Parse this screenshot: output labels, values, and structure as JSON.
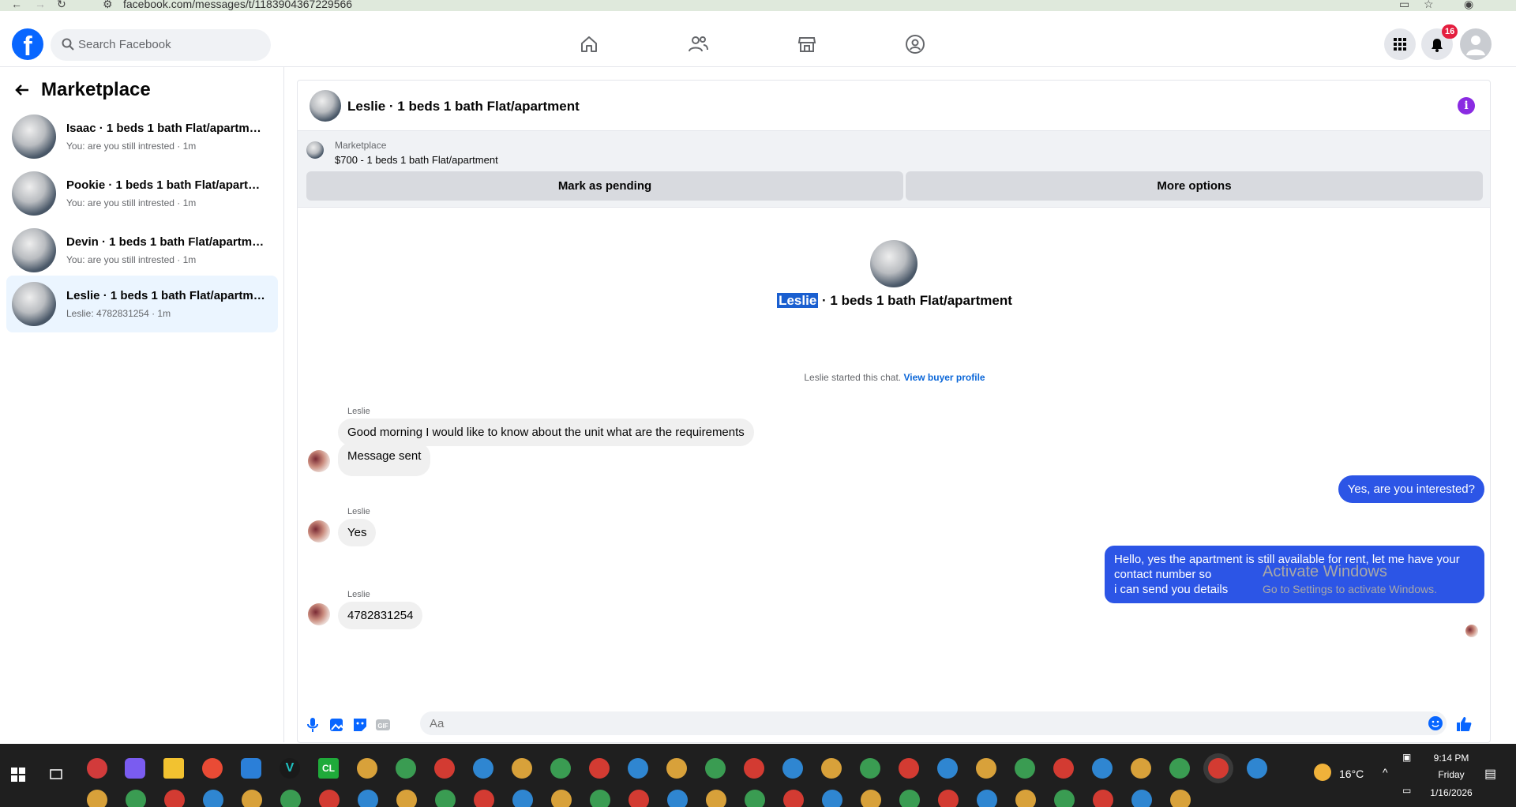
{
  "browser": {
    "url": "facebook.com/messages/t/1183904367229566"
  },
  "topbar": {
    "search_placeholder": "Search Facebook",
    "notifications_count": "16",
    "nav_icons": [
      "home-icon",
      "friends-icon",
      "marketplace-icon",
      "groups-icon"
    ]
  },
  "sidebar": {
    "title": "Marketplace",
    "conversations": [
      {
        "name": "Isaac · 1 beds 1 bath Flat/apartment",
        "snippet": "You: are you still intrested · 1m"
      },
      {
        "name": "Pookie · 1 beds 1 bath Flat/apartment",
        "snippet": "You: are you still intrested · 1m"
      },
      {
        "name": "Devin · 1 beds 1 bath Flat/apartment",
        "snippet": "You: are you still intrested · 1m"
      },
      {
        "name": "Leslie · 1 beds 1 bath Flat/apartment",
        "snippet": "Leslie: 4782831254 · 1m"
      }
    ]
  },
  "chat": {
    "title": "Leslie · 1 beds 1 bath Flat/apartment",
    "listing": {
      "label": "Marketplace",
      "description": "$700 - 1 beds 1 bath Flat/apartment",
      "mark_pending": "Mark as pending",
      "more_options": "More options"
    },
    "intro": {
      "name_highlight": "Leslie",
      "name_rest": " · 1 beds 1 bath Flat/apartment",
      "started": "Leslie started this chat. ",
      "view_profile": "View buyer profile"
    },
    "messages": [
      {
        "sender": "Leslie",
        "text": "Good morning I would like to know about the unit what are the requirements"
      },
      {
        "text": "Message sent"
      },
      {
        "text": "Yes, are you interested?"
      },
      {
        "sender": "Leslie",
        "text": "Yes"
      },
      {
        "text": "Hello, yes the apartment is still available for rent, let me have your contact number so"
      },
      {
        "text": "i can send you details"
      },
      {
        "sender": "Leslie",
        "text": "4782831254"
      }
    ],
    "composer_placeholder": "Aa"
  },
  "watermark": {
    "line1": "Activate Windows",
    "line2": "Go to Settings to activate Windows."
  },
  "taskbar": {
    "weather": "16°C",
    "time": "9:14 PM",
    "day": "Friday",
    "date": "1/16/2026"
  },
  "colors": {
    "brand": "#0866ff",
    "outgoing_bubble": "#2c55e6",
    "incoming_bubble": "#f0f0f0",
    "active_conversation": "#ebf5ff",
    "notification_badge": "#e41e3f"
  }
}
